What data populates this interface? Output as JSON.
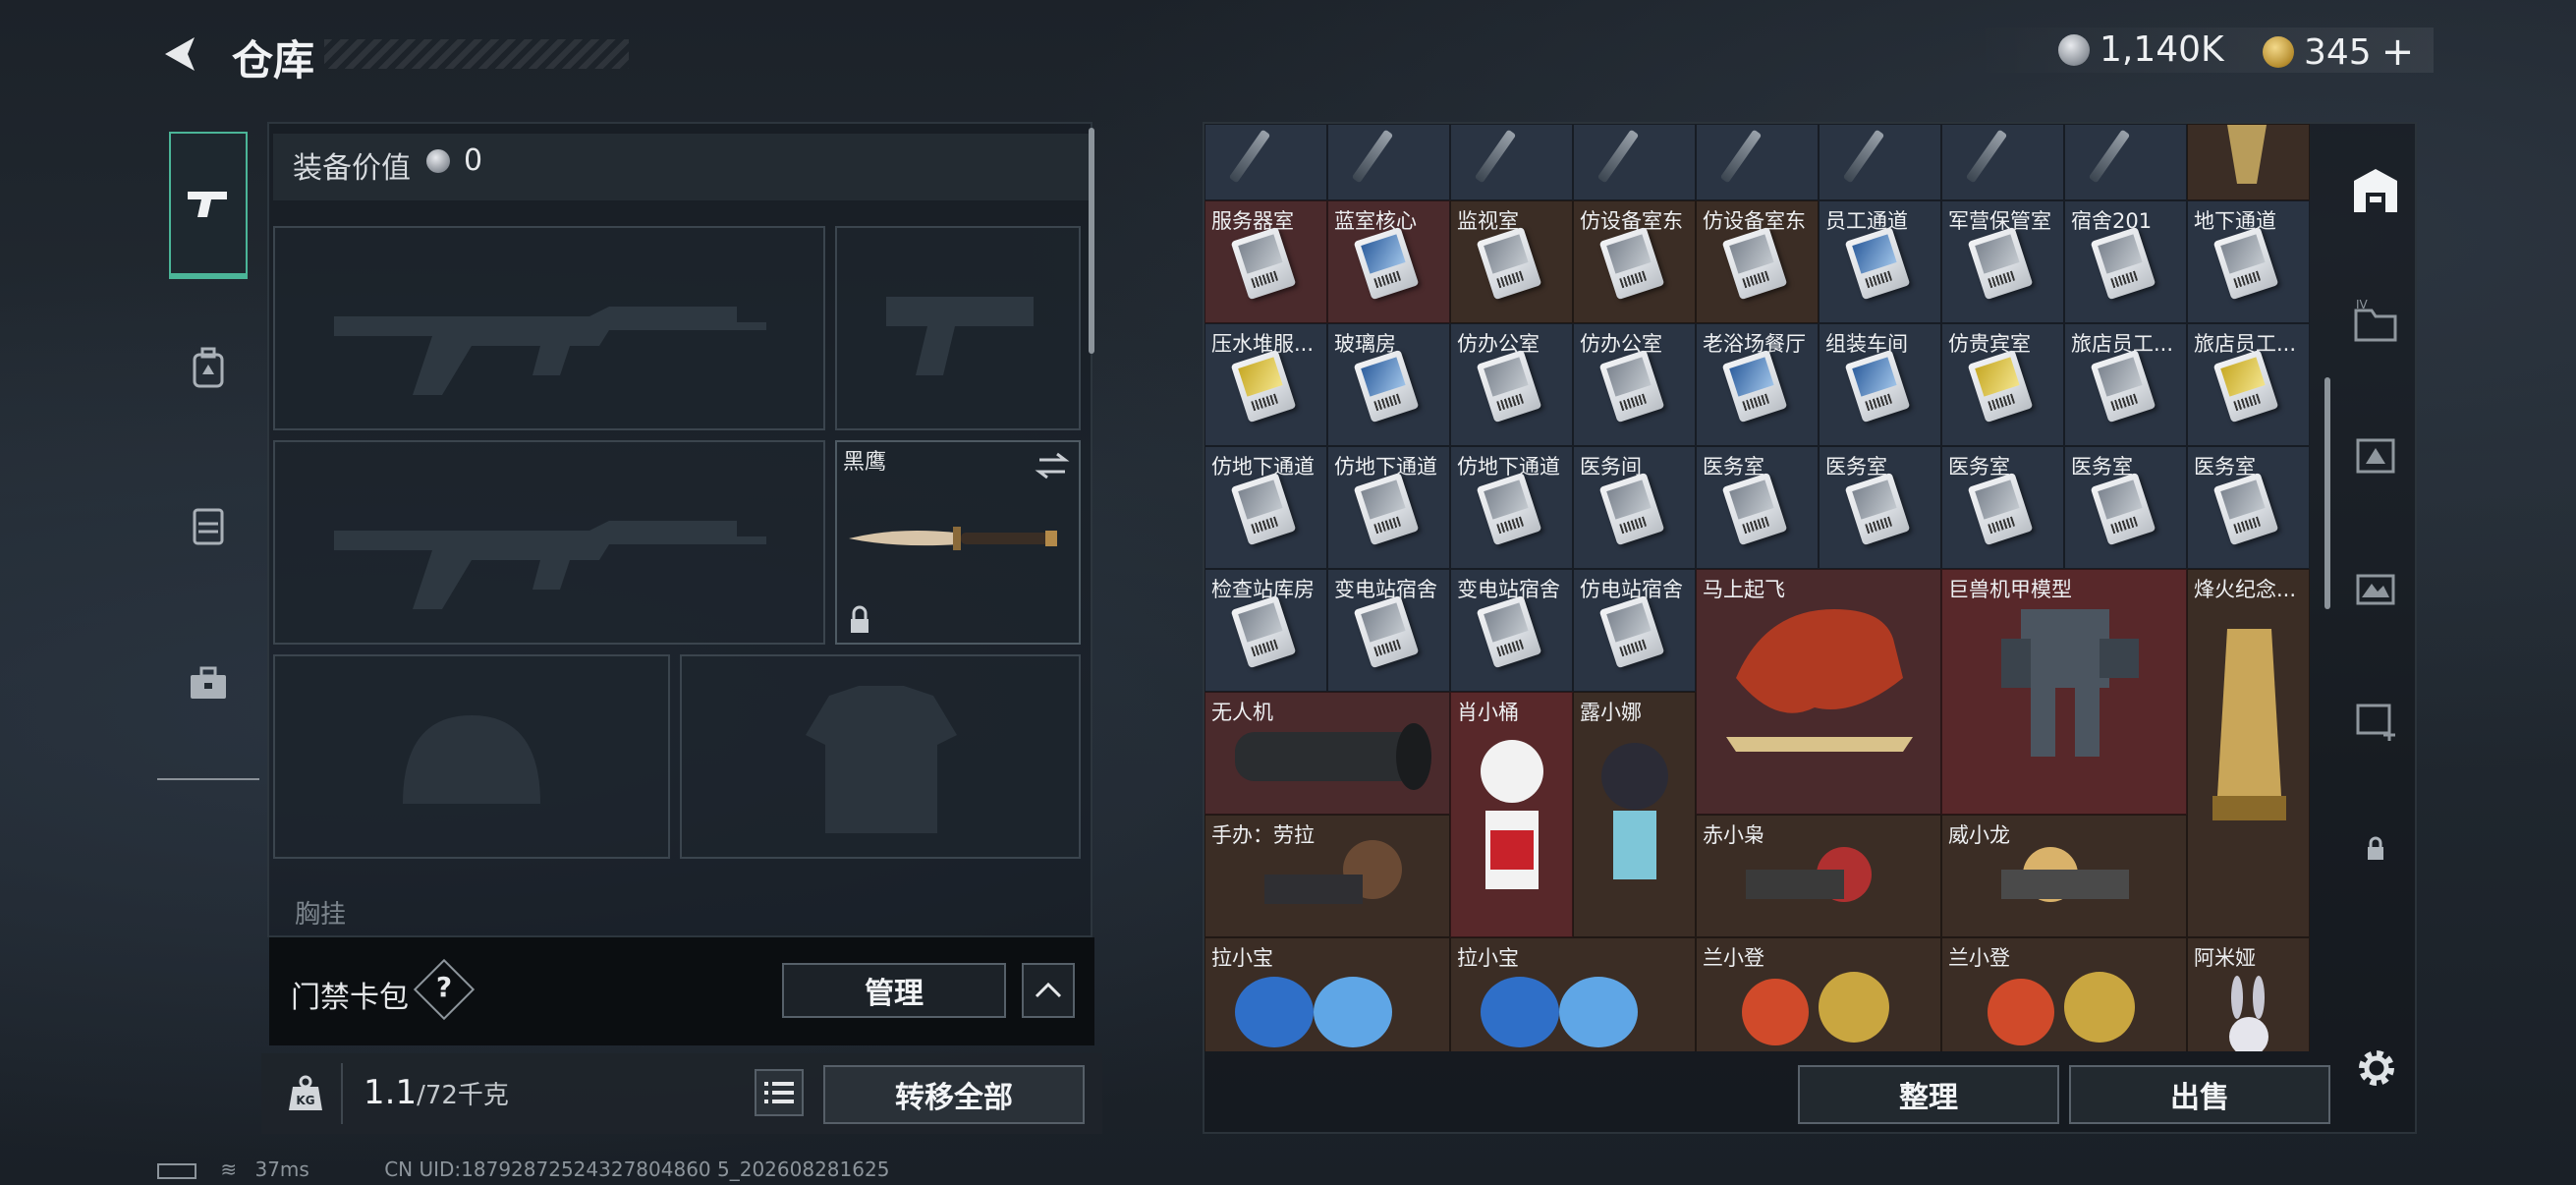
{
  "header": {
    "title": "仓库",
    "currency_silver": "1,140K",
    "currency_gold": "345",
    "gold_plus": "+"
  },
  "equipment": {
    "value_label": "装备价值",
    "value": "0",
    "knife_name": "黑鹰",
    "next_section": "胸挂"
  },
  "keybag": {
    "label": "门禁卡包",
    "help": "?",
    "manage": "管理"
  },
  "weight": {
    "current": "1.1",
    "max": "/72千克"
  },
  "actions": {
    "transfer_all": "转移全部",
    "sort": "整理",
    "sell": "出售"
  },
  "storage": {
    "top_row_items": 9,
    "labels": [
      "服务器室",
      "蓝室核心",
      "监视室",
      "仿设备室东",
      "仿设备室东",
      "员工通道",
      "军营保管室",
      "宿舍201",
      "地下通道",
      "压水堆服...",
      "玻璃房",
      "仿办公室",
      "仿办公室",
      "老浴场餐厅",
      "组装车间",
      "仿贵宾室",
      "旅店员工...",
      "旅店员工...",
      "仿地下通道",
      "仿地下通道",
      "仿地下通道",
      "医务间",
      "医务室",
      "医务室",
      "医务室",
      "医务室",
      "医务室",
      "检查站库房",
      "变电站宿舍",
      "变电站宿舍",
      "仿电站宿舍",
      "马上起飞",
      "巨兽机甲模型",
      "烽火纪念...",
      "无人机",
      "肖小桶",
      "露小娜",
      "手办：劳拉",
      "赤小枭",
      "威小龙",
      "拉小宝",
      "拉小宝",
      "兰小登",
      "兰小登",
      "阿米娅"
    ]
  },
  "footer": {
    "ping": "37ms",
    "uid": "CN UID:18792872524327804860 5_202608281625"
  }
}
